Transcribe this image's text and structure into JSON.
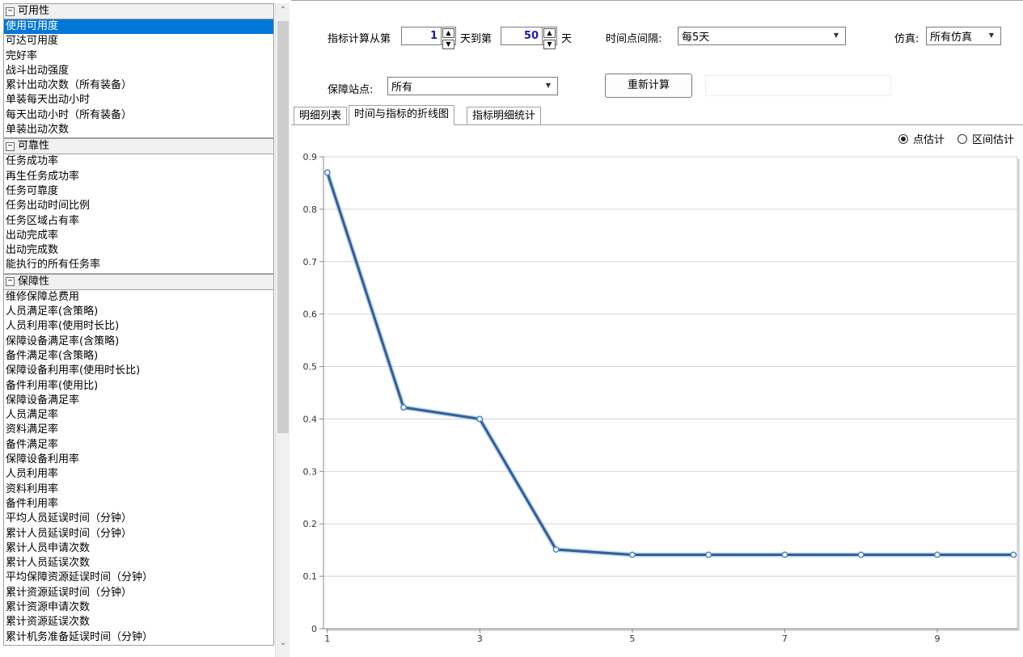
{
  "left_panel": {
    "groups": [
      {
        "title": "可用性",
        "items": [
          "使用可用度",
          "可达可用度",
          "完好率",
          "战斗出动强度",
          "累计出动次数（所有装备）",
          "单装每天出动小时",
          "每天出动小时（所有装备）",
          "单装出动次数"
        ],
        "selected_index": 0
      },
      {
        "title": "可靠性",
        "items": [
          "任务成功率",
          "再生任务成功率",
          "任务可靠度",
          "任务出动时间比例",
          "任务区域占有率",
          "出动完成率",
          "出动完成数",
          "能执行的所有任务率"
        ]
      },
      {
        "title": "保障性",
        "items": [
          "维修保障总费用",
          "人员满足率(含策略)",
          "人员利用率(使用时长比)",
          "保障设备满足率(含策略)",
          "备件满足率(含策略)",
          "保障设备利用率(使用时长比)",
          "备件利用率(使用比)",
          "保障设备满足率",
          "人员满足率",
          "资料满足率",
          "备件满足率",
          "保障设备利用率",
          "人员利用率",
          "资料利用率",
          "备件利用率",
          "平均人员延误时间（分钟）",
          "累计人员延误时间（分钟）",
          "累计人员申请次数",
          "累计人员延误次数",
          "平均保障资源延误时间（分钟）",
          "累计资源延误时间（分钟）",
          "累计资源申请次数",
          "累计资源延误次数",
          "累计机务准备延误时间（分钟）"
        ]
      }
    ]
  },
  "controls": {
    "range_label_prefix": "指标计算从第",
    "start_day": "1",
    "range_label_middle": "天到第",
    "end_day": "50",
    "range_label_suffix": "天",
    "interval_label": "时间点间隔:",
    "interval_value": "每5天",
    "sim_label": "仿真:",
    "sim_value": "所有仿真",
    "station_label": "保障站点:",
    "station_value": "所有",
    "recalc_label": "重新计算"
  },
  "tabs": [
    {
      "label": "明细列表",
      "active": false
    },
    {
      "label": "时间与指标的折线图",
      "active": true
    },
    {
      "label": "指标明细统计",
      "active": false
    }
  ],
  "estimate_mode": {
    "point_label": "点估计",
    "interval_label": "区间估计",
    "selected": "point"
  },
  "chart_data": {
    "type": "line",
    "x": [
      1,
      2,
      3,
      4,
      5,
      6,
      7,
      8,
      9,
      10
    ],
    "series": [
      {
        "values": [
          0.87,
          0.422,
          0.4,
          0.151,
          0.141,
          0.141,
          0.141,
          0.141,
          0.141,
          0.141
        ],
        "color": "#2e5f99"
      }
    ],
    "x_tick_labels": [
      "1",
      "3",
      "5",
      "7",
      "9"
    ],
    "x_tick_values": [
      1,
      3,
      5,
      7,
      9
    ],
    "y_ticks": [
      0,
      0.1,
      0.2,
      0.3,
      0.4,
      0.5,
      0.6,
      0.7,
      0.8,
      0.9
    ],
    "y_tick_labels": [
      "0",
      "0.1",
      "0.2",
      "0.3",
      "0.4",
      "0.5",
      "0.6",
      "0.7",
      "0.8",
      "0.9"
    ],
    "ylim": [
      0,
      0.9
    ],
    "xlim": [
      0.95,
      10.05
    ],
    "grid": true,
    "title": "",
    "xlabel": "",
    "ylabel": ""
  }
}
